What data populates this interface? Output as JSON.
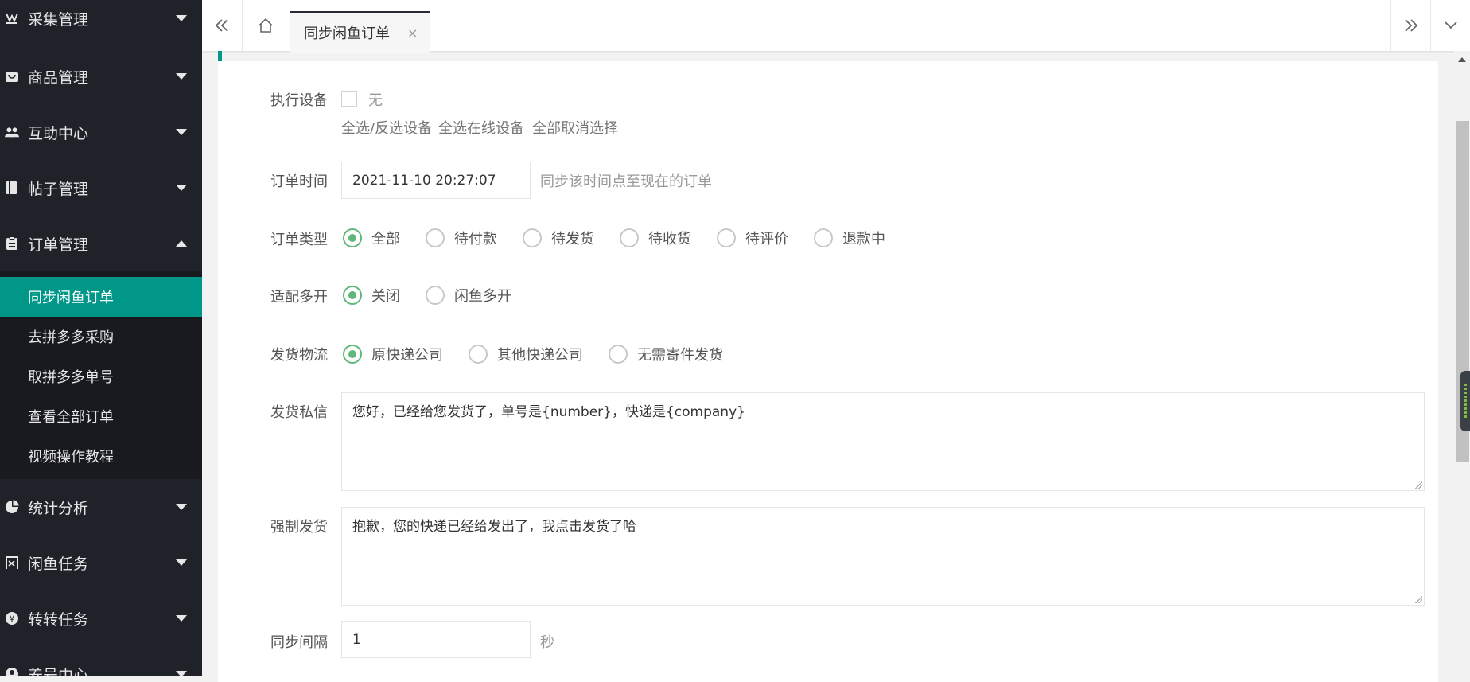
{
  "colors": {
    "sidebar_bg": "#20222a",
    "submenu_bg": "#181a20",
    "accent": "#009688",
    "radio_checked": "#5fb878"
  },
  "sidebar": {
    "items": [
      {
        "label": "采集管理",
        "icon": "collect-icon",
        "expanded": false
      },
      {
        "label": "商品管理",
        "icon": "bag-icon",
        "expanded": false
      },
      {
        "label": "互助中心",
        "icon": "users-icon",
        "expanded": false
      },
      {
        "label": "帖子管理",
        "icon": "book-icon",
        "expanded": false
      },
      {
        "label": "订单管理",
        "icon": "clipboard-icon",
        "expanded": true
      },
      {
        "label": "统计分析",
        "icon": "pie-chart-icon",
        "expanded": false
      },
      {
        "label": "闲鱼任务",
        "icon": "xianyu-icon",
        "expanded": false
      },
      {
        "label": "转转任务",
        "icon": "zhuanzhuan-icon",
        "expanded": false
      },
      {
        "label": "养号中心",
        "icon": "account-icon",
        "expanded": false
      }
    ],
    "submenu": [
      {
        "label": "同步闲鱼订单",
        "active": true
      },
      {
        "label": "去拼多多采购",
        "active": false
      },
      {
        "label": "取拼多多单号",
        "active": false
      },
      {
        "label": "查看全部订单",
        "active": false
      },
      {
        "label": "视频操作教程",
        "active": false
      }
    ]
  },
  "tabs": {
    "active_label": "同步闲鱼订单",
    "close_glyph": "×"
  },
  "form": {
    "device": {
      "label": "执行设备",
      "option": "无",
      "links": [
        "全选/反选设备",
        "全选在线设备",
        "全部取消选择"
      ]
    },
    "order_time": {
      "label": "订单时间",
      "value": "2021-11-10 20:27:07",
      "hint": "同步该时间点至现在的订单"
    },
    "order_type": {
      "label": "订单类型",
      "options": [
        "全部",
        "待付款",
        "待发货",
        "待收货",
        "待评价",
        "退款中"
      ],
      "selected": "全部"
    },
    "multi_open": {
      "label": "适配多开",
      "options": [
        "关闭",
        "闲鱼多开"
      ],
      "selected": "关闭"
    },
    "logistics": {
      "label": "发货物流",
      "options": [
        "原快递公司",
        "其他快递公司",
        "无需寄件发货"
      ],
      "selected": "原快递公司"
    },
    "ship_message": {
      "label": "发货私信",
      "value": "您好，已经给您发货了，单号是{number}，快递是{company}"
    },
    "force_ship": {
      "label": "强制发货",
      "value": "抱歉，您的快递已经给发出了，我点击发货了哈"
    },
    "sync_interval": {
      "label": "同步间隔",
      "value": "1",
      "unit": "秒"
    }
  }
}
